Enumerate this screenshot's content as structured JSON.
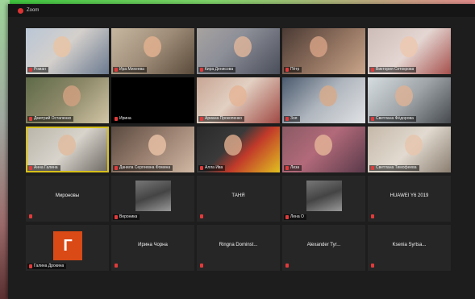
{
  "window": {
    "title": "Zoom"
  },
  "participants": [
    {
      "name": "Роман",
      "type": "video",
      "bg": "linear-gradient(135deg,#b9c6d6 0%,#d4d0cc 45%,#6b7a90 100%)",
      "face": "#e8c4a6"
    },
    {
      "name": "Ира Михеева",
      "type": "video",
      "bg": "linear-gradient(135deg,#c7b7a0 0%,#9e8c78 50%,#5a4a3a 100%)",
      "face": "#e0b08e"
    },
    {
      "name": "Кира Денисова",
      "type": "video",
      "bg": "linear-gradient(135deg,#a7a3a0 0%,#8d8f98 40%,#4a4e5a 100%)",
      "face": "#dcb49a"
    },
    {
      "name": "Пётр",
      "type": "video",
      "bg": "linear-gradient(135deg,#4a3a34 0%,#8c6e5c 50%,#c9a58a 100%)",
      "face": "#d4a084"
    },
    {
      "name": "Виктория Сетокрова",
      "type": "video",
      "bg": "linear-gradient(135deg,#cdbcb8 0%,#e4d6d2 50%,#a6504c 100%)",
      "face": "#ecc8b0"
    },
    {
      "name": "Дмитрий Остапенко",
      "type": "video",
      "bg": "linear-gradient(135deg,#5e6a48 0%,#8e8a6a 50%,#d2c6a6 100%)",
      "face": "#cfa080"
    },
    {
      "name": "Ирина",
      "type": "black"
    },
    {
      "name": "Ариана Прокопенко",
      "type": "video",
      "bg": "linear-gradient(135deg,#c8a594 0%,#e2d0c2 45%,#a04a44 100%)",
      "face": "#e4b596"
    },
    {
      "name": "Зоя",
      "type": "video",
      "bg": "linear-gradient(135deg,#4a5a6e 0%,#b0b6be 50%,#e0e2e4 100%)",
      "face": "#d6aa8c"
    },
    {
      "name": "Светлана Фёдорова",
      "type": "video",
      "bg": "linear-gradient(135deg,#d6dde0 0%,#9ea4a8 50%,#464a4e 100%)",
      "face": "#dcb296"
    },
    {
      "name": "Анна Галина",
      "type": "video",
      "highlight": true,
      "bg": "linear-gradient(135deg,#b8b4a8 0%,#d8d4cc 50%,#6a6660 100%)",
      "face": "#e0bca0"
    },
    {
      "name": "Данила Сергеевна Фомина",
      "type": "video",
      "bg": "linear-gradient(135deg,#5a4a40 0%,#9a8070 50%,#d0b8a4 100%)",
      "face": "#e6c0a4"
    },
    {
      "name": "Алла Ива",
      "type": "video",
      "bg": "linear-gradient(135deg,#2a2a2a 0%,#3a3a3a 40%,#c23a2a 60%,#e0c020 100%)",
      "face": "#d8a88a"
    },
    {
      "name": "Лиза",
      "type": "video",
      "bg": "linear-gradient(135deg,#8a5a64 0%,#b26a7a 45%,#5a3a4a 100%)",
      "face": "#e2b296"
    },
    {
      "name": "Светлана Тимофеева",
      "type": "video",
      "bg": "linear-gradient(135deg,#c4b8a8 0%,#e2dad0 50%,#8a7e70 100%)",
      "face": "#e6c6ae"
    },
    {
      "name": "",
      "type": "text",
      "label": "Мироновы"
    },
    {
      "name": "Вероника",
      "type": "photo"
    },
    {
      "name": "",
      "type": "text",
      "label": "ТАНЯ"
    },
    {
      "name": "Лена О",
      "type": "photo"
    },
    {
      "name": "",
      "type": "text",
      "label": "HUAWEI Y6 2019"
    },
    {
      "name": "Галина Дрокина",
      "type": "letter",
      "letter": "Г"
    },
    {
      "name": "",
      "type": "text",
      "label": "Ирина Чорна"
    },
    {
      "name": "",
      "type": "text",
      "label": "Ringna Dominst..."
    },
    {
      "name": "",
      "type": "text",
      "label": "Alexander Tyr..."
    },
    {
      "name": "",
      "type": "text",
      "label": "Ksenia Syrtsa..."
    }
  ]
}
